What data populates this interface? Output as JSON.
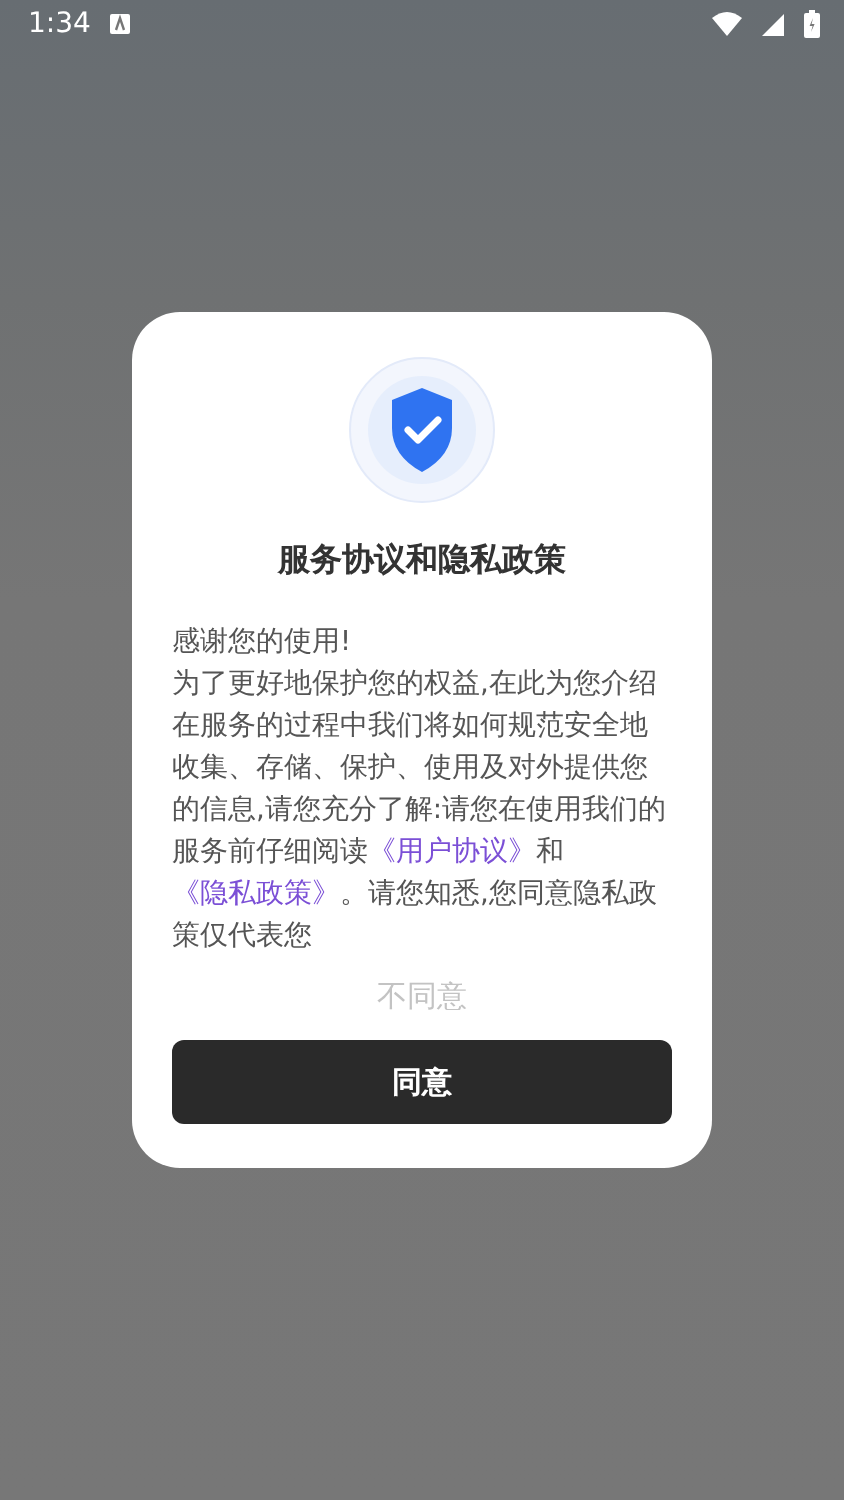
{
  "status_bar": {
    "time": "1:34"
  },
  "dialog": {
    "title": "服务协议和隐私政策",
    "greeting": "感谢您的使用!",
    "body": [
      {
        "kind": "text",
        "text": "为了更好地保护您的权益,在此为您介绍在服务的过程中我们将如何规范安全地收集、存储、保护、使用及对外提供您的信息,请您充分了解:请您在使用我们的服务前仔细阅读"
      },
      {
        "kind": "link",
        "text": "《用户协议》"
      },
      {
        "kind": "text",
        "text": "和"
      },
      {
        "kind": "link",
        "text": "《隐私政策》"
      },
      {
        "kind": "text",
        "text": "。请您知悉,您同意隐私政策仅代表您"
      }
    ],
    "decline": "不同意",
    "accept": "同意"
  }
}
